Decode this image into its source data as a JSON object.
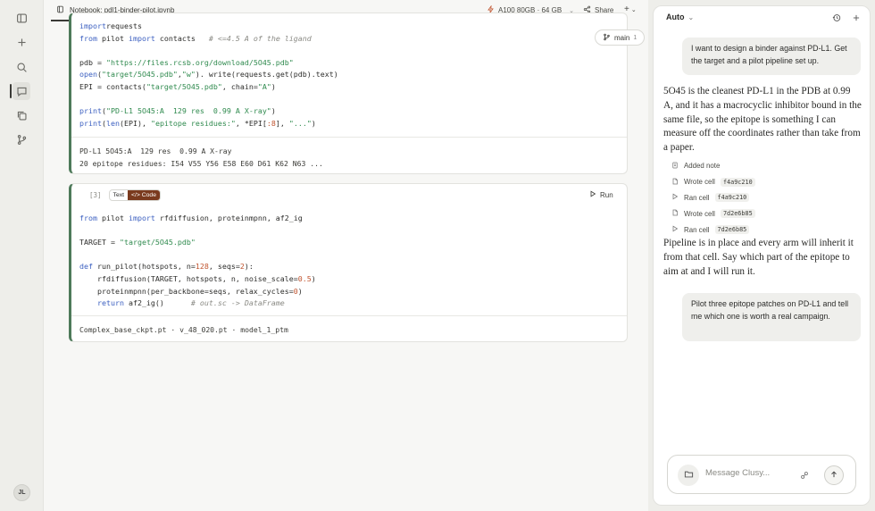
{
  "rail": {
    "avatar_initials": "JL",
    "icons": [
      "sidebar-toggle-icon",
      "plus-icon",
      "search-icon",
      "chat-icon",
      "copy-icon",
      "branch-icon"
    ]
  },
  "topbar": {
    "tab_title": "Notebook: pdl1-binder-pilot.ipynb",
    "gpu_label": "A100 80GB · 64 GB",
    "share_label": "Share",
    "plus_label": "+"
  },
  "cell1": {
    "branch_label": "main",
    "branch_count": "1",
    "code_lines": [
      [
        [
          "kw",
          "import"
        ],
        [
          "",
          "requests"
        ]
      ],
      [
        [
          "kw",
          "from"
        ],
        [
          "",
          " pilot "
        ],
        [
          "kw",
          "import"
        ],
        [
          "",
          " contacts   "
        ],
        [
          "cm",
          "# <=4.5 A of the ligand"
        ]
      ],
      [],
      [
        [
          "",
          "pdb = "
        ],
        [
          "str",
          "\"https://files.rcsb.org/download/5O45.pdb\""
        ]
      ],
      [
        [
          "kw",
          "open"
        ],
        [
          "",
          "("
        ],
        [
          "str",
          "\"target/5O45.pdb\""
        ],
        [
          "",
          ","
        ],
        [
          "str",
          "\"w\""
        ],
        [
          "",
          "). write(requests.get(pdb).text)"
        ]
      ],
      [
        [
          "",
          "EPI = contacts("
        ],
        [
          "str",
          "\"target/5O45.pdb\""
        ],
        [
          "",
          ", chain="
        ],
        [
          "str",
          "\"A\""
        ],
        [
          "",
          ")"
        ]
      ],
      [],
      [
        [
          "kw",
          "print"
        ],
        [
          "",
          "("
        ],
        [
          "str",
          "\"PD-L1 5O45:A  129 res  0.99 A X-ray\""
        ],
        [
          "",
          ")"
        ]
      ],
      [
        [
          "kw",
          "print"
        ],
        [
          "",
          "("
        ],
        [
          "kw",
          "len"
        ],
        [
          "",
          "(EPI), "
        ],
        [
          "str",
          "\"epitope residues:\""
        ],
        [
          "",
          ", *EPI["
        ],
        [
          "num",
          ":8"
        ],
        [
          "",
          "], "
        ],
        [
          "str",
          "\"...\""
        ],
        [
          "",
          ")"
        ]
      ]
    ],
    "output_lines": [
      "PD-L1 5O45:A  129 res  0.99 A X-ray",
      "20 epitope residues: I54 V55 Y56 E58 E60 D61 K62 N63 ..."
    ]
  },
  "cell2": {
    "cell_number": "[3]",
    "toggle_text": "Text",
    "toggle_code": "</> Code",
    "run_label": "Run",
    "code_lines": [
      [
        [
          "kw",
          "from"
        ],
        [
          "",
          " pilot "
        ],
        [
          "kw",
          "import"
        ],
        [
          "",
          " rfdiffusion, proteinmpnn, af2_ig"
        ]
      ],
      [],
      [
        [
          "",
          "TARGET = "
        ],
        [
          "str",
          "\"target/5O45.pdb\""
        ]
      ],
      [],
      [
        [
          "kw",
          "def"
        ],
        [
          "",
          " run_pilot(hotspots, n="
        ],
        [
          "num",
          "128"
        ],
        [
          "",
          ", seqs="
        ],
        [
          "num",
          "2"
        ],
        [
          "",
          "):"
        ]
      ],
      [
        [
          "",
          "    rfdiffusion(TARGET, hotspots, n, noise_scale="
        ],
        [
          "num",
          "0.5"
        ],
        [
          "",
          ")"
        ]
      ],
      [
        [
          "",
          "    proteinmpnn(per_backbone=seqs, relax_cycles="
        ],
        [
          "num",
          "0"
        ],
        [
          "",
          ")"
        ]
      ],
      [
        [
          "kw",
          "    return"
        ],
        [
          "",
          " af2_ig()      "
        ],
        [
          "cm",
          "# out.sc -> DataFrame"
        ]
      ]
    ],
    "output_lines": [
      "Complex_base_ckpt.pt · v_48_020.pt · model_1_ptm"
    ]
  },
  "chat": {
    "mode_label": "Auto",
    "user_msg_1": "I want to design a binder against PD-L1. Get the target and a pilot pipeline set up.",
    "assistant_msg_1": "5O45 is the cleanest PD-L1 in the PDB at 0.99 A, and it has a macrocyclic inhibitor bound in the same file, so the epitope is something I can measure off the coordinates rather than take from a paper.",
    "steps": [
      {
        "label": "Added note",
        "hash": ""
      },
      {
        "label": "Wrote cell",
        "hash": "f4a9c210"
      },
      {
        "label": "Ran cell",
        "hash": "f4a9c210"
      },
      {
        "label": "Wrote cell",
        "hash": "7d2e6b85"
      },
      {
        "label": "Ran cell",
        "hash": "7d2e6b85"
      }
    ],
    "assistant_msg_2": "Pipeline is in place and every arm will inherit it from that cell. Say which part of the epitope to aim at and I will run it.",
    "user_msg_2": "Pilot three epitope patches on PD-L1 and tell me which one is worth a real campaign.",
    "input_placeholder": "Message Clusy..."
  }
}
